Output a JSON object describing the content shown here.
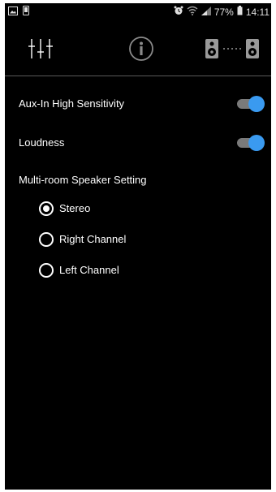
{
  "status_bar": {
    "battery_percent": "77%",
    "time": "14:11",
    "left_icons": [
      "gallery-icon",
      "phone-device-icon"
    ],
    "right_icons": [
      "alarm-icon",
      "wifi-icon",
      "signal-icon",
      "battery-icon"
    ]
  },
  "toolbar": {
    "tabs": [
      {
        "icon": "equalizer-icon"
      },
      {
        "icon": "info-icon"
      },
      {
        "icon": "speaker-pair-icon"
      }
    ]
  },
  "settings": {
    "aux_in": {
      "label": "Aux-In High Sensitivity",
      "enabled": true
    },
    "loudness": {
      "label": "Loudness",
      "enabled": true
    }
  },
  "multiroom": {
    "label": "Multi-room Speaker Setting",
    "selected": "Stereo",
    "options": [
      {
        "label": "Stereo"
      },
      {
        "label": "Right Channel"
      },
      {
        "label": "Left Channel"
      }
    ]
  },
  "colors": {
    "background": "#000000",
    "toggle_thumb": "#3a9af0",
    "toggle_track": "#7a7a7a",
    "text": "#ffffff"
  }
}
